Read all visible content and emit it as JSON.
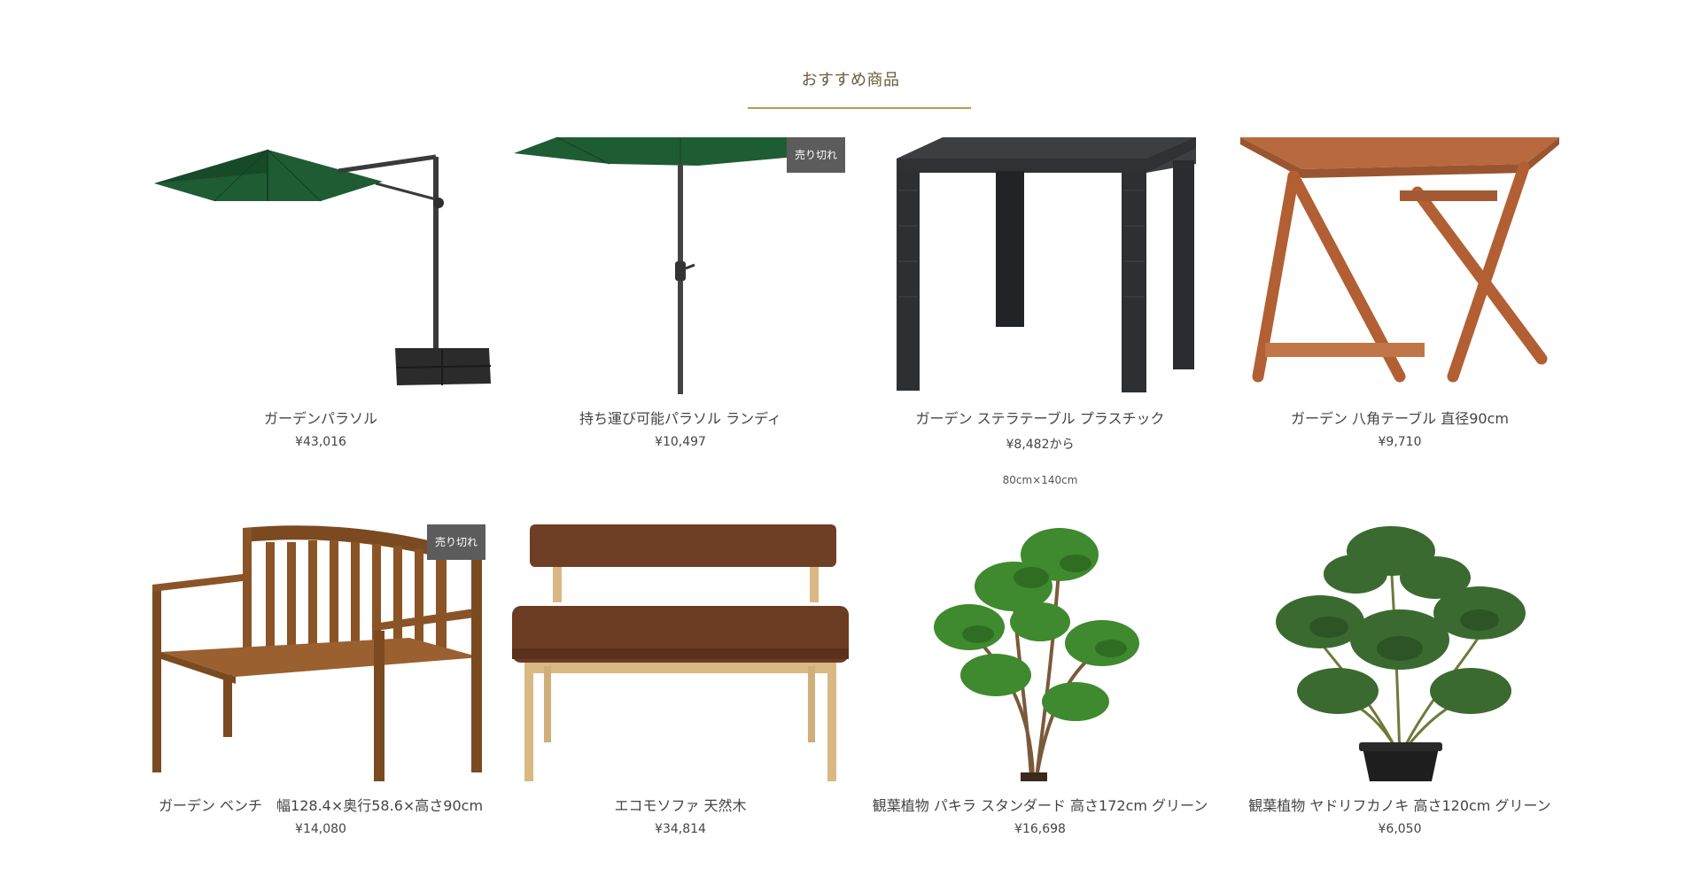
{
  "section": {
    "title": "おすすめ商品"
  },
  "colors": {
    "accent_underline": "#b99a55",
    "badge_bg": "#5c5c5c"
  },
  "products": [
    {
      "name": "ガーデンパラソル",
      "price": "¥43,016",
      "sold_out": "",
      "variant": "",
      "icon": "cantilever-parasol-image"
    },
    {
      "name": "持ち運び可能パラソル ランディ",
      "price": "¥10,497",
      "sold_out": "売り切れ",
      "variant": "",
      "icon": "market-parasol-image"
    },
    {
      "name": "ガーデン ステラテーブル プラスチック",
      "price": "¥8,482から",
      "sold_out": "",
      "variant": "80cm×140cm",
      "icon": "rattan-table-image"
    },
    {
      "name": "ガーデン 八角テーブル 直径90cm",
      "price": "¥9,710",
      "sold_out": "",
      "variant": "",
      "icon": "octagon-wood-table-image"
    },
    {
      "name": "ガーデン ベンチ　幅128.4×奥行58.6×高さ90cm",
      "price": "¥14,080",
      "sold_out": "売り切れ",
      "variant": "",
      "icon": "wood-bench-image"
    },
    {
      "name": "エコモソファ 天然木",
      "price": "¥34,814",
      "sold_out": "",
      "variant": "",
      "icon": "leather-sofa-bench-image"
    },
    {
      "name": "観葉植物 パキラ スタンダード 高さ172cm グリーン",
      "price": "¥16,698",
      "sold_out": "",
      "variant": "",
      "icon": "pachira-plant-image"
    },
    {
      "name": "観葉植物 ヤドリフカノキ 高さ120cm グリーン",
      "price": "¥6,050",
      "sold_out": "",
      "variant": "",
      "icon": "schefflera-plant-image"
    }
  ]
}
